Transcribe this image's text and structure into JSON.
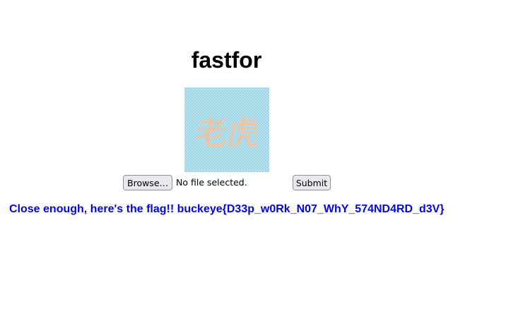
{
  "page": {
    "title": "fastfor"
  },
  "image": {
    "glyph_text": "老虎",
    "background_color": "#a9dbe9",
    "glyph_color": "#f2c2a0"
  },
  "form": {
    "browse_label": "Browse…",
    "file_status": "No file selected.",
    "submit_label": "Submit"
  },
  "result": {
    "message": "Close enough, here's the flag!! buckeye{D33p_w0Rk_N07_WhY_574ND4RD_d3V}",
    "color": "#0000ee"
  }
}
